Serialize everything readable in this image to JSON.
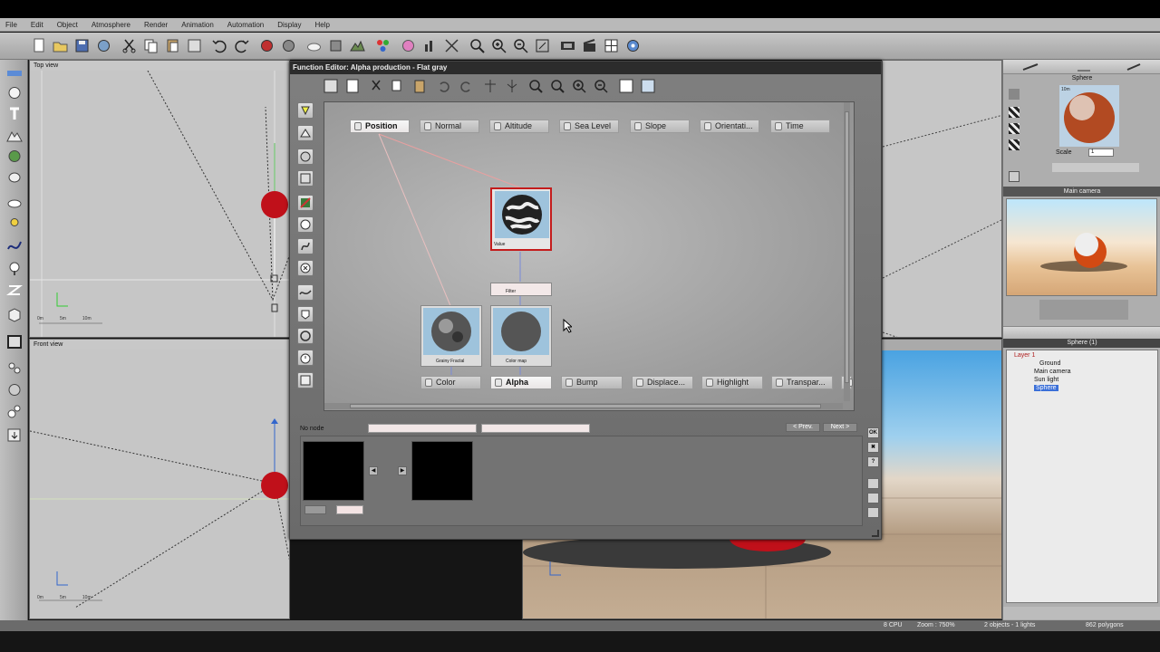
{
  "menu": [
    "File",
    "Edit",
    "Object",
    "Atmosphere",
    "Render",
    "Animation",
    "Automation",
    "Display",
    "Help"
  ],
  "viewports": {
    "top": {
      "title": "Top view",
      "scale": [
        "0m",
        "5m",
        "10m"
      ]
    },
    "front": {
      "title": "Front view",
      "scale": [
        "0m",
        "5m",
        "10m"
      ]
    }
  },
  "function_editor": {
    "title": "Function Editor: Alpha production - Flat gray",
    "inputs": [
      "Position",
      "Normal",
      "Altitude",
      "Sea Level",
      "Slope",
      "Orientati...",
      "Time"
    ],
    "outputs": [
      "Color",
      "Alpha",
      "Bump",
      "Displace...",
      "Highlight",
      "Transpar..."
    ],
    "nodes": {
      "value": "Value",
      "filter": "Filter",
      "fractal": "Grainy Fractal",
      "colormap": "Color map"
    },
    "bottom": {
      "label": "No node",
      "prev": "< Prev.",
      "next": "Next >"
    },
    "side_buttons": {
      "ok": "OK",
      "close": "✖",
      "help": "?"
    }
  },
  "right_panel": {
    "object_name": "Sphere",
    "scale_label": "Scale",
    "scale_value": "1",
    "camera_label": "Main camera",
    "preview_badge": "10m",
    "tree_header": "Sphere (1)",
    "tree": [
      "Layer 1",
      "Ground",
      "Main camera",
      "Sun light",
      "Sphere"
    ]
  },
  "status": {
    "cpu": "8 CPU",
    "zoom": "Zoom : 750%",
    "selection": "2 objects - 1 lights",
    "polygons": "862 polygons"
  },
  "colors": {
    "accent_red": "#c0101a",
    "selected_blue": "#3a6fd8"
  }
}
